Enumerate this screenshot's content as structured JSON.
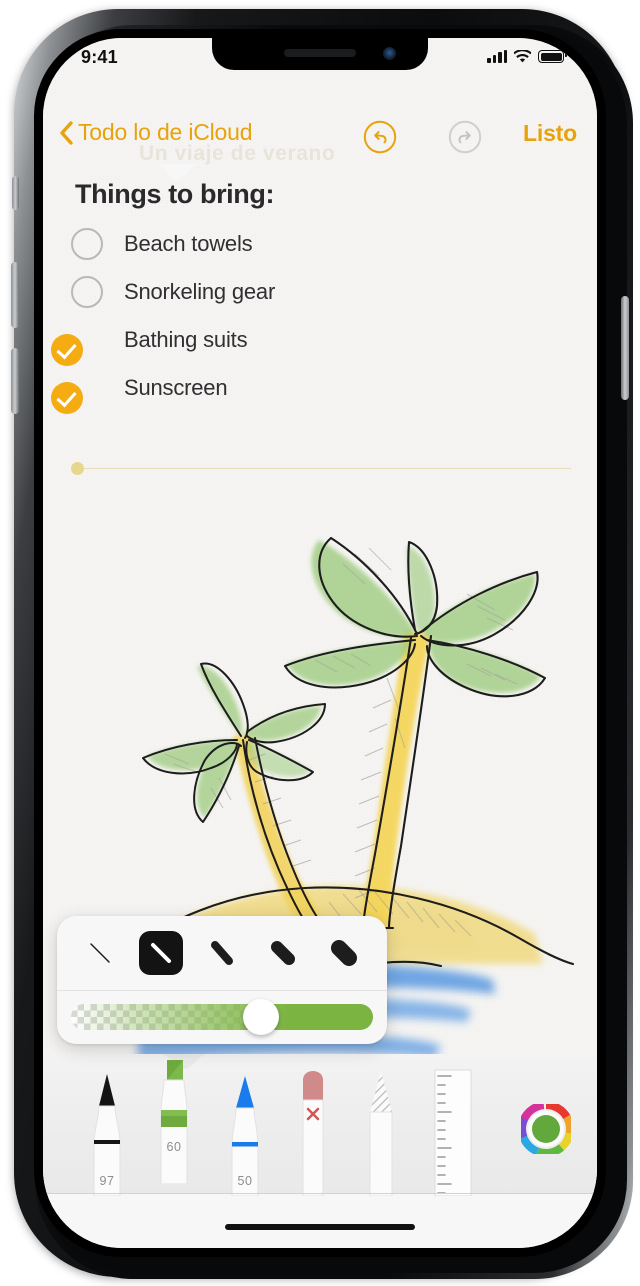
{
  "device": {
    "name": "iPhone X"
  },
  "status_bar": {
    "time": "9:41",
    "cellular_icon": "signal-bars-icon",
    "wifi_icon": "wifi-icon",
    "battery_icon": "battery-full-icon"
  },
  "nav_bar": {
    "back_label": "Todo lo de iCloud",
    "back_icon": "chevron-left-icon",
    "undo_icon": "undo-icon",
    "undo_enabled": true,
    "redo_icon": "redo-icon",
    "redo_enabled": false,
    "done_label": "Listo",
    "accent_color": "#e8a30c",
    "disabled_color": "#c9c9c9"
  },
  "note": {
    "title": "Things to bring:",
    "ghost_text": "Un viaje de verano",
    "checklist": [
      {
        "label": "Beach towels",
        "checked": false
      },
      {
        "label": "Snorkeling gear",
        "checked": false
      },
      {
        "label": "Bathing suits",
        "checked": true
      },
      {
        "label": "Sunscreen",
        "checked": true
      }
    ],
    "checked_color": "#f5ac12",
    "unchecked_border_color": "#b9b8b4",
    "divider_dot_color": "#e8d68c",
    "divider_line_color": "#e7ddb6",
    "drawing_description": "Hand-drawn sketch of two palm trees on a sandy island with blue water strokes",
    "drawing_colors": {
      "frond_green": "#9dcb7e",
      "trunk_yellow": "#f2d25a",
      "sand_yellow": "#f0d878",
      "water_blue": "#4f93e0",
      "ink": "#1d1d1d"
    }
  },
  "stroke_popover": {
    "widths": [
      {
        "name": "hairline",
        "selected": false
      },
      {
        "name": "thin",
        "selected": true
      },
      {
        "name": "medium",
        "selected": false
      },
      {
        "name": "thick",
        "selected": false
      },
      {
        "name": "extra-thick",
        "selected": false
      }
    ],
    "opacity_slider": {
      "value_percent": 60,
      "color": "#7cb441",
      "knob_color": "#ffffff"
    }
  },
  "tool_tray": {
    "tools": [
      {
        "name": "pen",
        "number": "97",
        "color": "#111111",
        "selected": false
      },
      {
        "name": "highlighter",
        "number": "60",
        "color": "#6faa3e",
        "selected": true
      },
      {
        "name": "marker",
        "number": "50",
        "color": "#1a7bed",
        "selected": false
      },
      {
        "name": "eraser",
        "number": "",
        "color": "#d08a8a",
        "selected": false
      },
      {
        "name": "lasso",
        "number": "",
        "color": "#b9b9b9",
        "selected": false
      },
      {
        "name": "ruler",
        "number": "",
        "color": "#c9c9c9",
        "selected": false
      }
    ],
    "color_picker": {
      "name": "color-wheel",
      "current_color": "#63a83c"
    }
  },
  "home_indicator": {
    "name": "home-indicator"
  }
}
